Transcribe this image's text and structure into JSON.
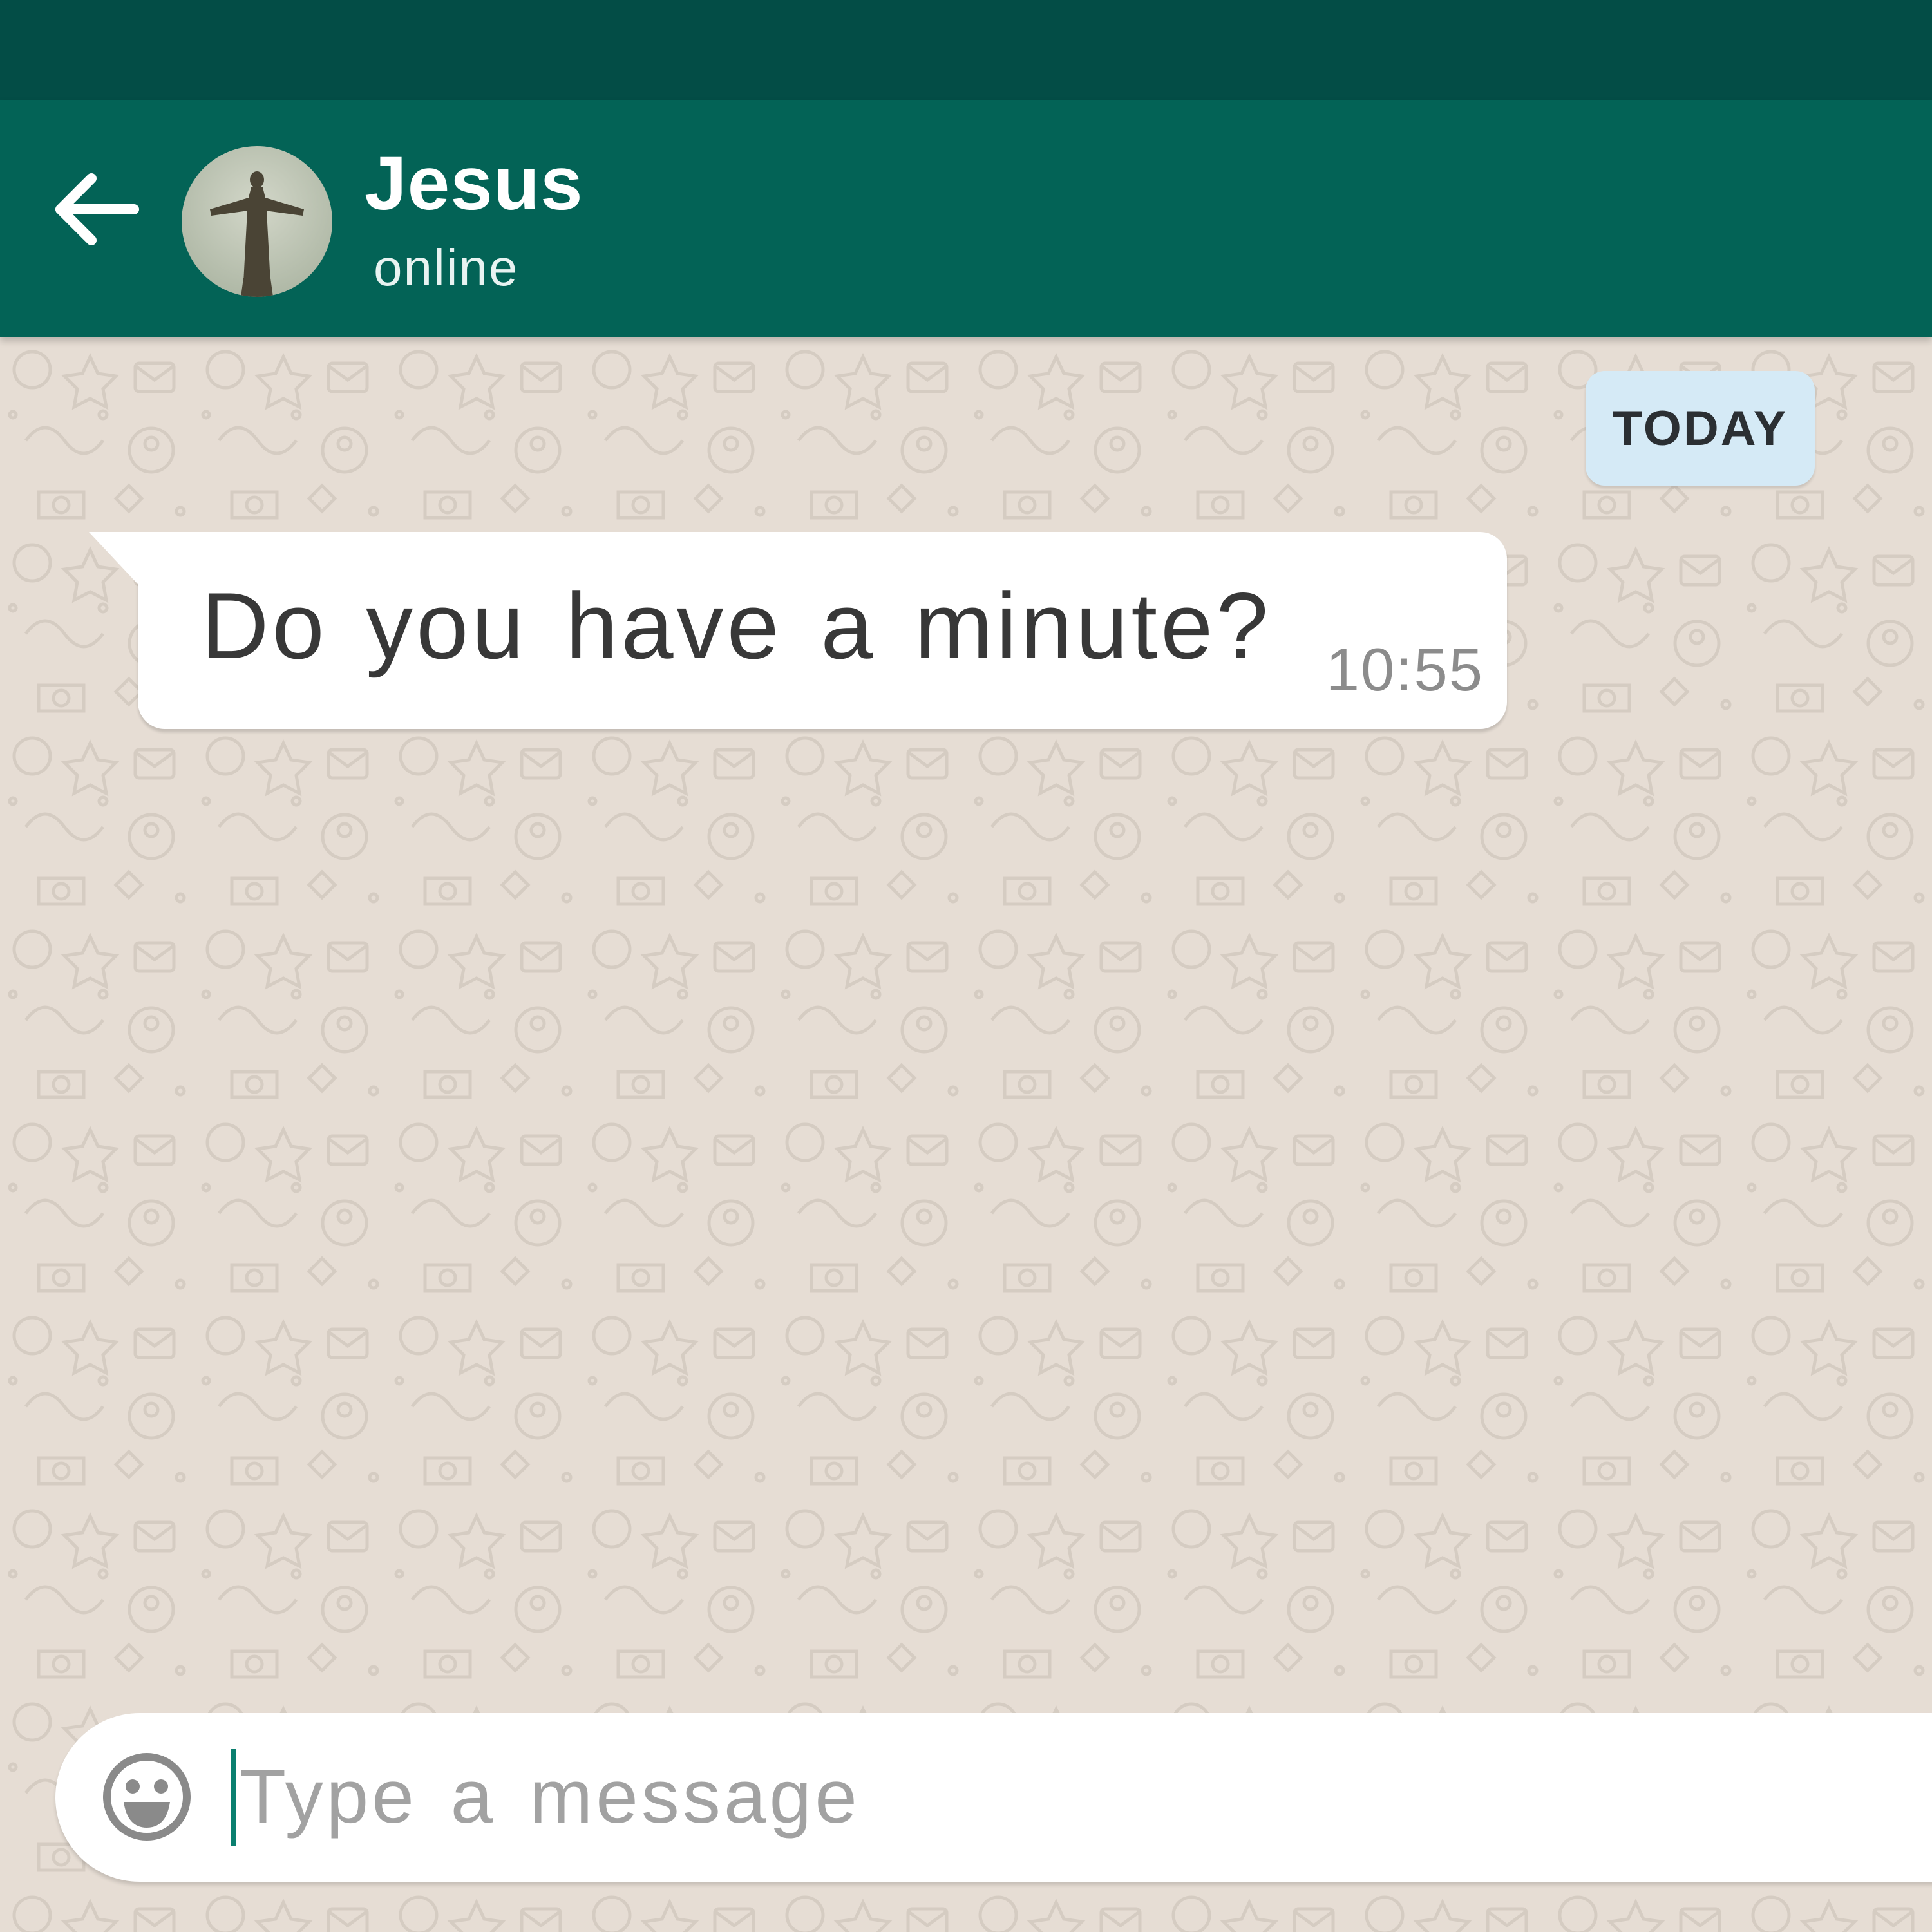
{
  "colors": {
    "status_bar": "#034d46",
    "app_bar": "#036356",
    "chat_background": "#e6ddd4",
    "date_chip": "#d5eaf6",
    "incoming_bubble": "#ffffff",
    "caret": "#0a7f6f"
  },
  "header": {
    "back_icon": "arrow-left-icon",
    "avatar": "contact-avatar-statue",
    "contact_name": "Jesus",
    "contact_status": "online"
  },
  "chat": {
    "date_label": "TODAY",
    "messages": [
      {
        "direction": "incoming",
        "text": "Do you have a minute?",
        "time": "10:55"
      }
    ]
  },
  "composer": {
    "emoji_icon": "smiley-icon",
    "placeholder": "Type a message",
    "value": ""
  }
}
